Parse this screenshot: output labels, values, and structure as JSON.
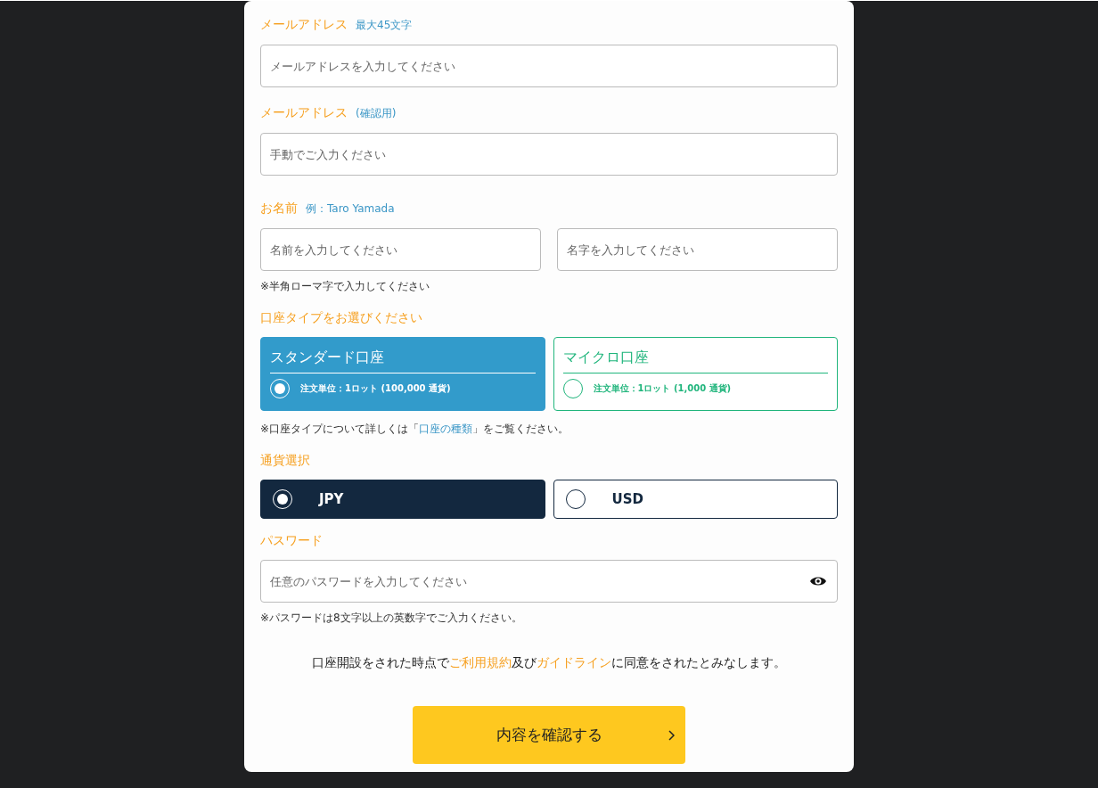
{
  "email": {
    "label": "メールアドレス",
    "note": "最大45文字",
    "placeholder": "メールアドレスを入力してください"
  },
  "email_confirm": {
    "label": "メールアドレス",
    "note": "(確認用)",
    "placeholder": "手動でご入力ください"
  },
  "name": {
    "label": "お名前",
    "note": "例：Taro Yamada",
    "first_placeholder": "名前を入力してください",
    "last_placeholder": "名字を入力してください",
    "hint": "※半角ローマ字で入力してください"
  },
  "account_type": {
    "label": "口座タイプをお選びください",
    "options": [
      {
        "title": "スタンダード口座",
        "detail": "注文単位：1ロット (100,000 通貨)",
        "selected": true,
        "color": "#329bcb"
      },
      {
        "title": "マイクロ口座",
        "detail": "注文単位：1ロット (1,000 通貨)",
        "selected": false,
        "color": "#20b57c"
      }
    ],
    "note_before": "※口座タイプについて詳しくは「",
    "note_link": "口座の種類",
    "note_after": "」をご覧ください。"
  },
  "currency": {
    "label": "通貨選択",
    "options": [
      {
        "label": "JPY",
        "selected": true
      },
      {
        "label": "USD",
        "selected": false
      }
    ]
  },
  "password": {
    "label": "パスワード",
    "placeholder": "任意のパスワードを入力してください",
    "hint": "※パスワードは8文字以上の英数字でご入力ください。"
  },
  "agreement": {
    "before": "口座開設をされた時点で",
    "link1": "ご利用規約",
    "middle": "及び",
    "link2": "ガイドライン",
    "after": "に同意をされたとみなします。"
  },
  "submit": {
    "label": "内容を確認する"
  }
}
